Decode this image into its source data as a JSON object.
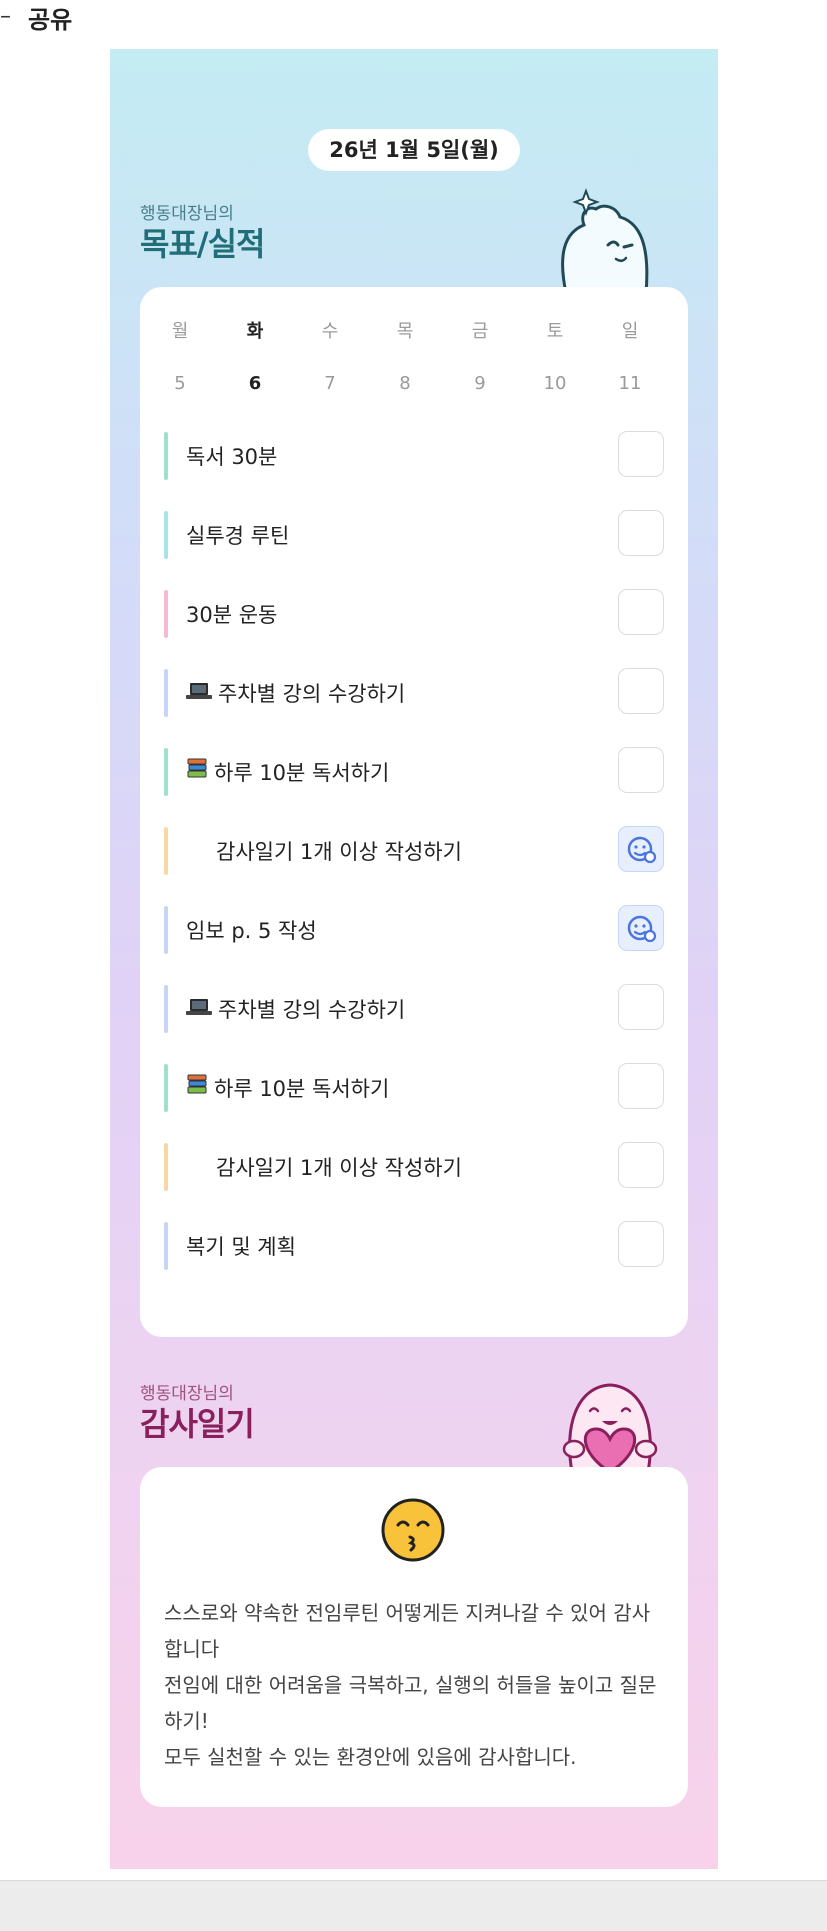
{
  "header": {
    "dash": "–",
    "share_label": "공유"
  },
  "date_label": "26년 1월 5일(월)",
  "goals_section": {
    "subtitle": "행동대장님의",
    "title": "목표/실적"
  },
  "week": {
    "days": [
      "월",
      "화",
      "수",
      "목",
      "금",
      "토",
      "일"
    ],
    "dates": [
      "5",
      "6",
      "7",
      "8",
      "9",
      "10",
      "11"
    ],
    "active_index": 1
  },
  "goals": [
    {
      "label": "독서 30분",
      "icon": "",
      "bar_color": "#9fe0c8",
      "checked": false,
      "indent": false
    },
    {
      "label": "실투경 루틴",
      "icon": "",
      "bar_color": "#a8e2ec",
      "checked": false,
      "indent": false
    },
    {
      "label": "30분 운동",
      "icon": "",
      "bar_color": "#f6b8d4",
      "checked": false,
      "indent": false
    },
    {
      "label": "주차별 강의 수강하기",
      "icon": "laptop-icon",
      "bar_color": "#c6d4f6",
      "checked": false,
      "indent": false
    },
    {
      "label": "하루 10분 독서하기",
      "icon": "books-icon",
      "bar_color": "#9fe0c8",
      "checked": false,
      "indent": false
    },
    {
      "label": "감사일기 1개 이상 작성하기",
      "icon": "",
      "bar_color": "#f8d6a6",
      "checked": true,
      "indent": true
    },
    {
      "label": "임보 p. 5 작성",
      "icon": "",
      "bar_color": "#c6d4f6",
      "checked": true,
      "indent": false
    },
    {
      "label": "주차별 강의 수강하기",
      "icon": "laptop-icon",
      "bar_color": "#c6d4f6",
      "checked": false,
      "indent": false
    },
    {
      "label": "하루 10분 독서하기",
      "icon": "books-icon",
      "bar_color": "#9fe0c8",
      "checked": false,
      "indent": false
    },
    {
      "label": "감사일기 1개 이상 작성하기",
      "icon": "",
      "bar_color": "#f8d6a6",
      "checked": false,
      "indent": true
    },
    {
      "label": "복기 및 계획",
      "icon": "",
      "bar_color": "#c6d4f6",
      "checked": false,
      "indent": false
    }
  ],
  "diary_section": {
    "subtitle": "행동대장님의",
    "title": "감사일기",
    "emoji": "kissing-face-icon",
    "lines": [
      "스스로와 약속한 전임루틴 어떻게든 지켜나갈 수 있어 감사합니다",
      "전임에 대한 어려움을 극복하고, 실행의 허들을 높이고 질문하기!",
      "모두 실천할 수 있는 환경안에 있음에 감사합니다."
    ]
  },
  "colors": {
    "goals_title": "#1f6e78",
    "diary_title": "#8a1f5e",
    "checked_icon": "#4a74e0"
  }
}
